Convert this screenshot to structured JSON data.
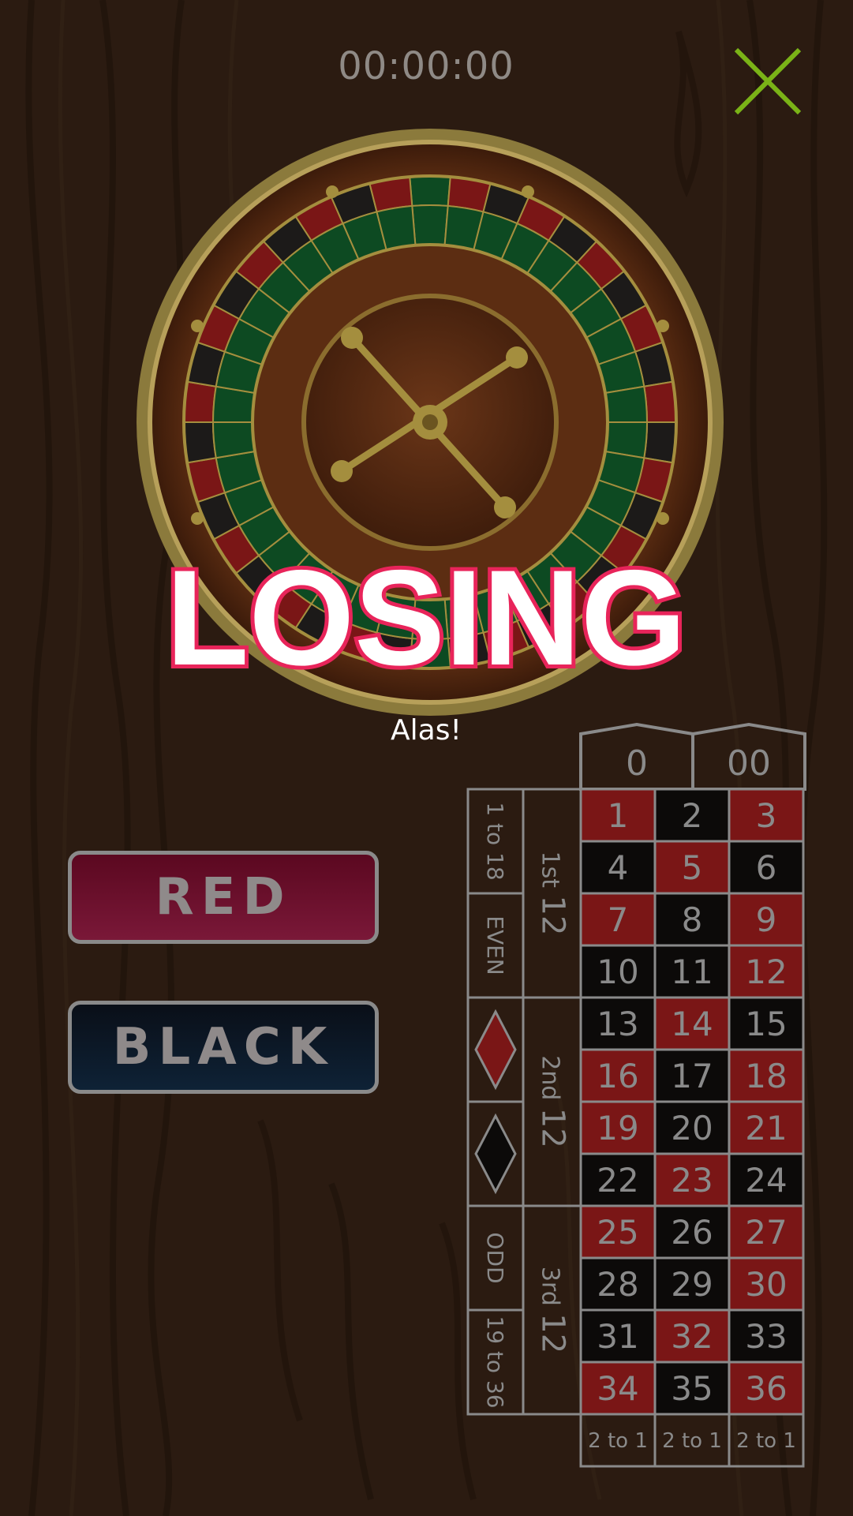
{
  "header": {
    "timer": "00:00:00"
  },
  "result": {
    "title": "LOSING",
    "subtitle": "Alas!"
  },
  "buttons": {
    "red_label": "RED",
    "black_label": "BLACK"
  },
  "table": {
    "zeros": [
      "0",
      "00"
    ],
    "outside_left": [
      "1 to 18",
      "EVEN",
      "red-diamond",
      "black-diamond",
      "ODD",
      "19 to 36"
    ],
    "dozens": [
      {
        "ordinal": "1st",
        "number": "12"
      },
      {
        "ordinal": "2nd",
        "number": "12"
      },
      {
        "ordinal": "3rd",
        "number": "12"
      }
    ],
    "numbers": [
      {
        "n": "1",
        "c": "red"
      },
      {
        "n": "2",
        "c": "black"
      },
      {
        "n": "3",
        "c": "red"
      },
      {
        "n": "4",
        "c": "black"
      },
      {
        "n": "5",
        "c": "red"
      },
      {
        "n": "6",
        "c": "black"
      },
      {
        "n": "7",
        "c": "red"
      },
      {
        "n": "8",
        "c": "black"
      },
      {
        "n": "9",
        "c": "red"
      },
      {
        "n": "10",
        "c": "black"
      },
      {
        "n": "11",
        "c": "black"
      },
      {
        "n": "12",
        "c": "red"
      },
      {
        "n": "13",
        "c": "black"
      },
      {
        "n": "14",
        "c": "red"
      },
      {
        "n": "15",
        "c": "black"
      },
      {
        "n": "16",
        "c": "red"
      },
      {
        "n": "17",
        "c": "black"
      },
      {
        "n": "18",
        "c": "red"
      },
      {
        "n": "19",
        "c": "red"
      },
      {
        "n": "20",
        "c": "black"
      },
      {
        "n": "21",
        "c": "red"
      },
      {
        "n": "22",
        "c": "black"
      },
      {
        "n": "23",
        "c": "red"
      },
      {
        "n": "24",
        "c": "black"
      },
      {
        "n": "25",
        "c": "red"
      },
      {
        "n": "26",
        "c": "black"
      },
      {
        "n": "27",
        "c": "red"
      },
      {
        "n": "28",
        "c": "black"
      },
      {
        "n": "29",
        "c": "black"
      },
      {
        "n": "30",
        "c": "red"
      },
      {
        "n": "31",
        "c": "black"
      },
      {
        "n": "32",
        "c": "red"
      },
      {
        "n": "33",
        "c": "black"
      },
      {
        "n": "34",
        "c": "red"
      },
      {
        "n": "35",
        "c": "black"
      },
      {
        "n": "36",
        "c": "red"
      }
    ],
    "column_bets": [
      "2 to 1",
      "2 to 1",
      "2 to 1"
    ]
  },
  "colors": {
    "red": "#7a1616",
    "black": "#0c0a09",
    "green": "#0d4a22",
    "gold": "#a48e3e",
    "accent_pink": "#e8245a",
    "close_green": "#7ab317"
  },
  "icons": {
    "close": "close-icon",
    "wheel": "roulette-wheel"
  }
}
